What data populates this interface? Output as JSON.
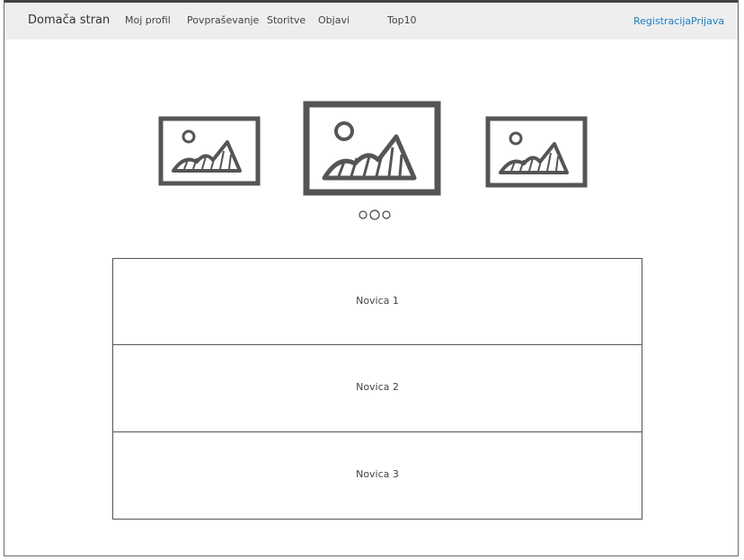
{
  "nav": {
    "brand": "Domača stran",
    "items": [
      "Moj profil",
      "Povpraševanje",
      "Storitve",
      "Objavi",
      "Top10"
    ],
    "right": [
      "Registracija",
      "Prijava"
    ]
  },
  "carousel": {
    "images": [
      "image-placeholder-icon",
      "image-placeholder-icon",
      "image-placeholder-icon"
    ],
    "dots_count": 3
  },
  "news": [
    "Novica 1",
    "Novica 2",
    "Novica 3"
  ]
}
